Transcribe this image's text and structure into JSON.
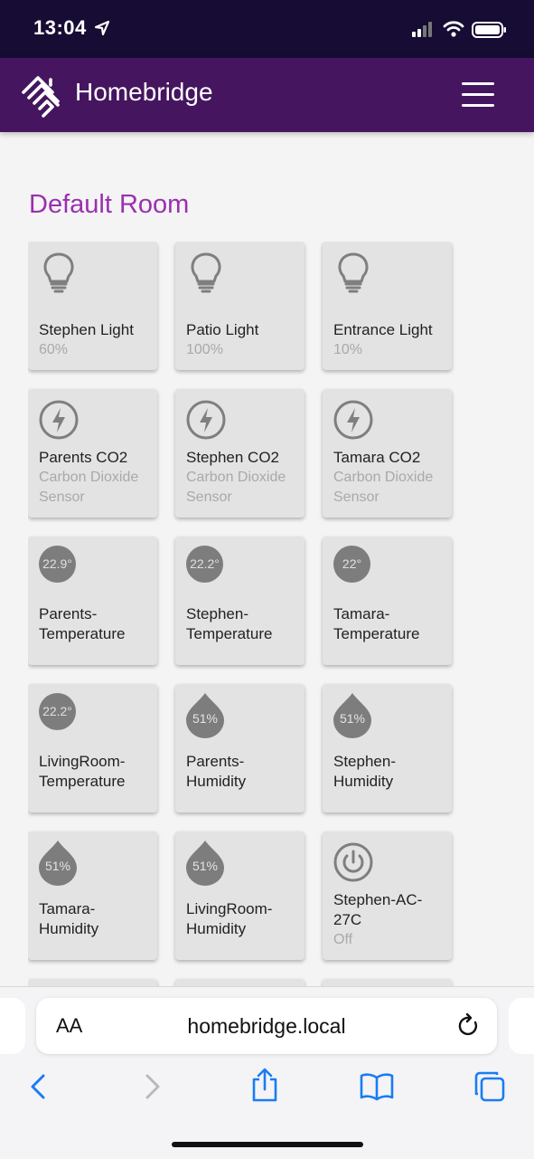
{
  "status_bar": {
    "time": "13:04"
  },
  "header": {
    "brand": "Homebridge"
  },
  "room": {
    "title": "Default Room",
    "tiles": [
      {
        "name": "Stephen Light",
        "status": "60%",
        "icon": "lightbulb-icon"
      },
      {
        "name": "Patio Light",
        "status": "100%",
        "icon": "lightbulb-icon"
      },
      {
        "name": "Entrance Light",
        "status": "10%",
        "icon": "lightbulb-icon"
      },
      {
        "name": "Parents CO2",
        "status": "Carbon Dioxide Sensor",
        "icon": "bolt-icon"
      },
      {
        "name": "Stephen CO2",
        "status": "Carbon Dioxide Sensor",
        "icon": "bolt-icon"
      },
      {
        "name": "Tamara CO2",
        "status": "Carbon Dioxide Sensor",
        "icon": "bolt-icon"
      },
      {
        "name": "Parents-Temperature",
        "reading": "22.9°",
        "icon": "temperature-icon"
      },
      {
        "name": "Stephen-Temperature",
        "reading": "22.2°",
        "icon": "temperature-icon"
      },
      {
        "name": "Tamara-Temperature",
        "reading": "22°",
        "icon": "temperature-icon"
      },
      {
        "name": "LivingRoom-Temperature",
        "reading": "22.2°",
        "icon": "temperature-icon"
      },
      {
        "name": "Parents-Humidity",
        "reading": "51%",
        "icon": "humidity-drop-icon"
      },
      {
        "name": "Stephen-Humidity",
        "reading": "51%",
        "icon": "humidity-drop-icon"
      },
      {
        "name": "Tamara-Humidity",
        "reading": "51%",
        "icon": "humidity-drop-icon"
      },
      {
        "name": "LivingRoom-Humidity",
        "reading": "51%",
        "icon": "humidity-drop-icon"
      },
      {
        "name": "Stephen-AC-27C",
        "status": "Off",
        "icon": "power-icon"
      }
    ]
  },
  "browser": {
    "text_size_label": "AA",
    "url": "homebridge.local"
  },
  "colors": {
    "navbar": "#45165f",
    "status_bar": "#170c33",
    "room_title": "#9b2fb0",
    "tile_bg": "#e3e3e3",
    "ios_blue": "#1a7cf4"
  }
}
